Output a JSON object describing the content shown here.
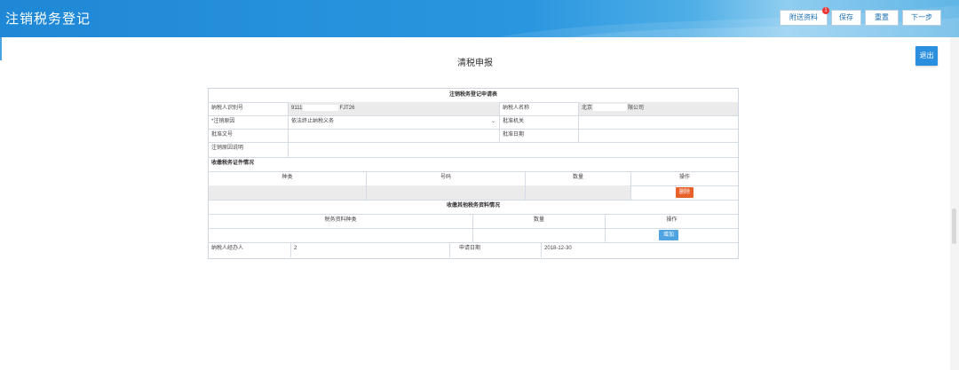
{
  "header": {
    "title": "注销税务登记",
    "buttons": {
      "attach": "附送资料",
      "attach_badge": "1",
      "save": "保存",
      "reset": "重置",
      "next": "下一步"
    }
  },
  "page": {
    "title": "清税申报",
    "side_button": "退出"
  },
  "form": {
    "section_title": "注销税务登记申请表",
    "taxpayer_id_label": "纳税人识别号",
    "taxpayer_id_prefix": "9111",
    "taxpayer_id_suffix": "FJT26",
    "taxpayer_name_label": "纳税人名称",
    "taxpayer_name_prefix": "北京",
    "taxpayer_name_suffix": "限公司",
    "reason_label": "*注销原因",
    "reason_value": "依法终止纳税义务",
    "approval_org_label": "批准机关",
    "approval_doc_label": "批准文号",
    "approval_date_label": "批准日期",
    "reason_desc_label": "注销原因说明",
    "cert_section_title": "收缴税务证件情况",
    "cert_headers": [
      "种类",
      "号码",
      "数量",
      "操作"
    ],
    "delete_button": "删除",
    "other_section_title": "收缴其他税务资料情况",
    "other_headers": [
      "税务资料种类",
      "数量",
      "操作"
    ],
    "add_button": "增加",
    "handler_label": "纳税人经办人",
    "handler_value": "2",
    "apply_date_label": "申请日期",
    "apply_date_value": "2018-12-30"
  }
}
